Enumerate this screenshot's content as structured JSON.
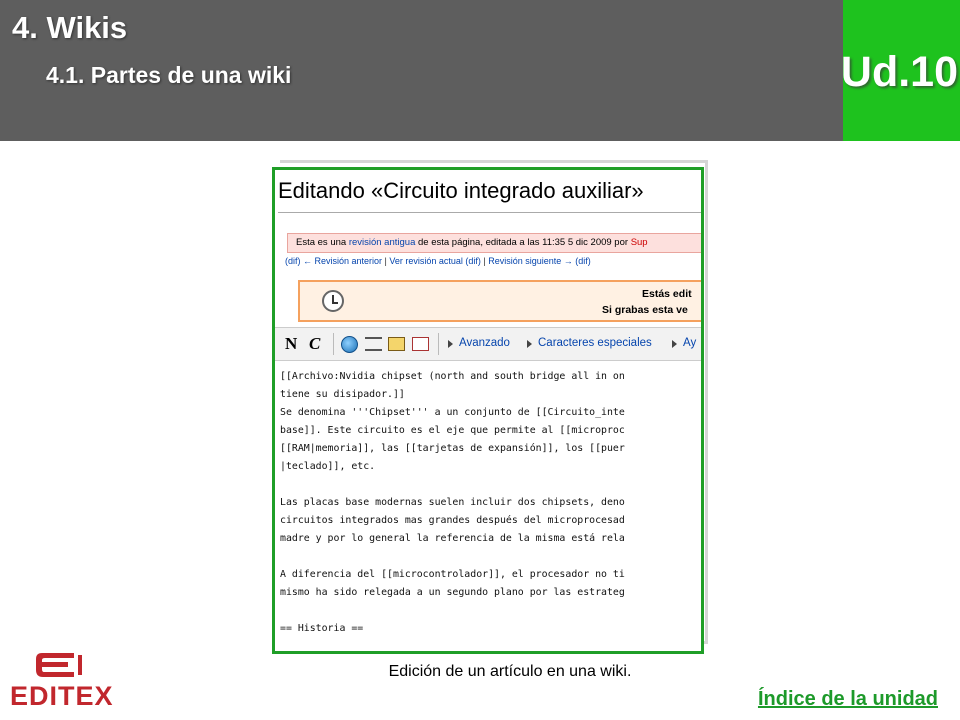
{
  "header": {
    "title": "4. Wikis",
    "subtitle": "4.1. Partes de una wiki",
    "unit": "Ud.10"
  },
  "screenshot": {
    "page_title": "Editando «Circuito integrado auxiliar»",
    "revision_notice": {
      "prefix": "Esta es una ",
      "link": "revisión antigua",
      "suffix": " de esta página, editada a las 11:35 5 dic 2009 por ",
      "user": "Sup"
    },
    "rev_nav": {
      "prev": "(dif) ← Revisión anterior",
      "current": "Ver revisión actual (dif)",
      "next": "Revisión siguiente → (dif)"
    },
    "warning": {
      "line1": "Estás edit",
      "line2": "Si grabas esta ve"
    },
    "toolbar": {
      "bold": "N",
      "italic": "C",
      "advanced": "Avanzado",
      "special_chars": "Caracteres especiales",
      "help": "Ay"
    },
    "code_lines": [
      "[[Archivo:Nvidia chipset (north and south bridge all in on",
      "tiene su disipador.]]",
      "Se denomina '''Chipset''' a un conjunto de [[Circuito_inte",
      "base]]. Este circuito es el eje que permite al [[microproc",
      "[[RAM|memoria]], las [[tarjetas de expansión]], los [[puer",
      "|teclado]], etc.",
      "",
      "Las placas base modernas suelen incluir dos chipsets, deno",
      "circuitos integrados mas grandes después del microprocesad",
      "madre y por lo general la referencia de la misma está rela",
      "",
      "A diferencia del [[microcontrolador]], el procesador no ti",
      "mismo ha sido relegada a un segundo plano por las estrateg",
      "",
      "== Historia =="
    ]
  },
  "caption": "Edición de un artículo en una wiki.",
  "logo_text": "EDITEX",
  "index_link": "Índice de la unidad",
  "colors": {
    "header_bg": "#5e5e5e",
    "unit_bg": "#1ec21e",
    "frame_border": "#1f9e27",
    "logo": "#c1272d",
    "index_link": "#1d9a2a"
  }
}
